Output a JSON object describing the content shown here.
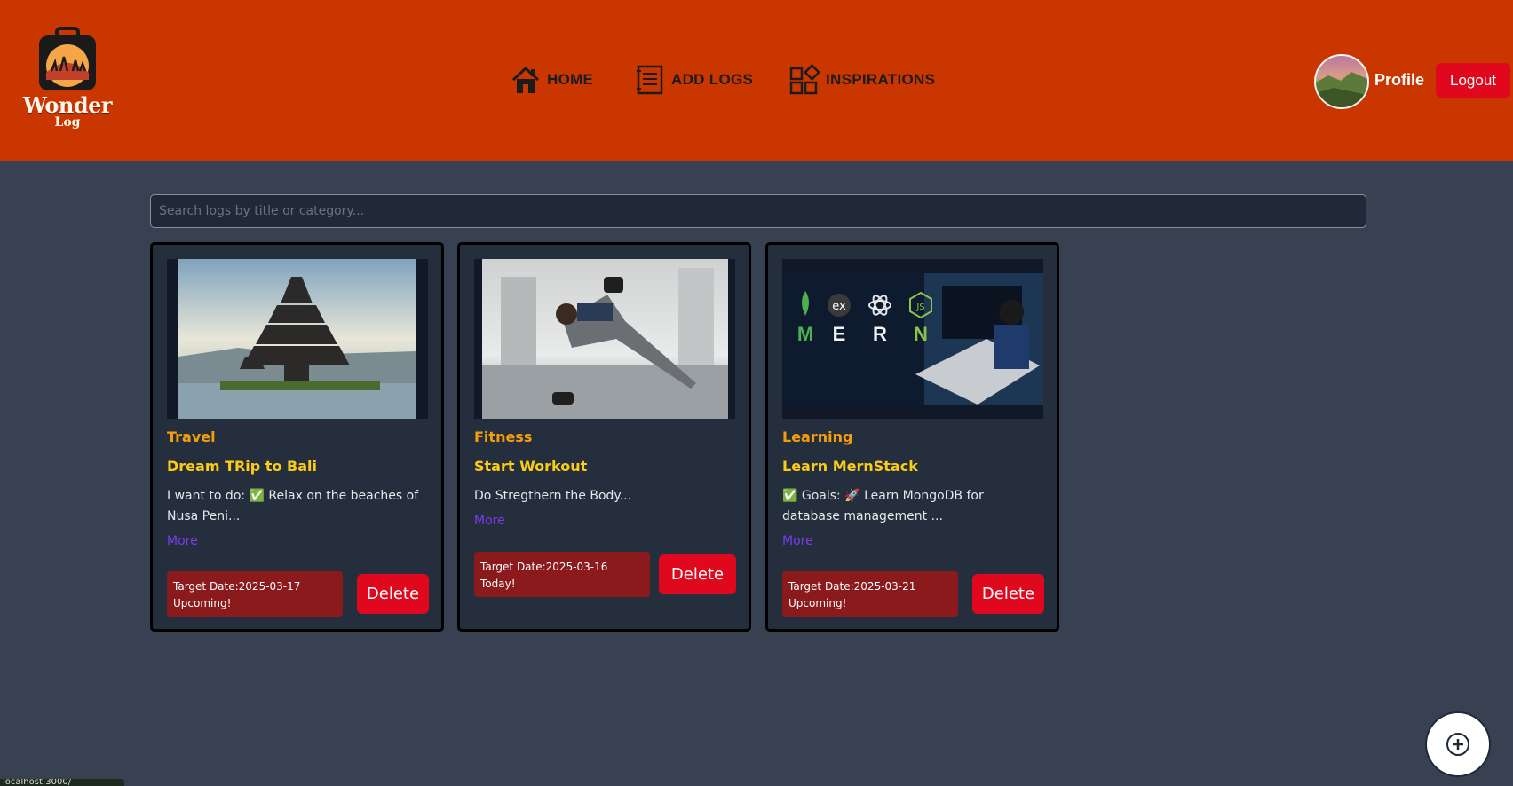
{
  "app": {
    "logo_word": "Wonder",
    "logo_sub": "Log"
  },
  "nav": {
    "items": [
      {
        "label": "HOME",
        "icon": "home-icon"
      },
      {
        "label": "ADD LOGS",
        "icon": "notebook-icon"
      },
      {
        "label": "INSPIRATIONS",
        "icon": "grid-icon"
      }
    ]
  },
  "user": {
    "profile_label": "Profile",
    "logout_label": "Logout"
  },
  "search": {
    "placeholder": "Search logs by title or category...",
    "value": ""
  },
  "cards": [
    {
      "category": "Travel",
      "title": "Dream TRip to Bali",
      "description": "I want to do: ✅ Relax on the beaches of Nusa Peni...",
      "more_label": "More",
      "target_date": "Target Date:2025-03-17",
      "status": "Upcoming!",
      "delete_label": "Delete"
    },
    {
      "category": "Fitness",
      "title": "Start Workout",
      "description": "Do Stregthern the Body...",
      "more_label": "More",
      "target_date": "Target Date:2025-03-16",
      "status": "Today!",
      "delete_label": "Delete"
    },
    {
      "category": "Learning",
      "title": "Learn MernStack",
      "description": "✅ Goals: 🚀 Learn MongoDB for database management ...",
      "more_label": "More",
      "target_date": "Target Date:2025-03-21",
      "status": "Upcoming!",
      "delete_label": "Delete",
      "image_letters": [
        "M",
        "E",
        "R",
        "N"
      ],
      "image_badges": [
        "ex",
        "JS"
      ]
    }
  ],
  "fab": {
    "icon": "plus-icon"
  },
  "status_bar": {
    "text": "localhost:3000/"
  },
  "colors": {
    "header": "#c93600",
    "background": "#374151",
    "card": "#252e3c",
    "category": "#f59e0b",
    "title": "#facc15",
    "more": "#7c3aed",
    "danger": "#e0081d",
    "date_box": "#8b1a1d"
  }
}
